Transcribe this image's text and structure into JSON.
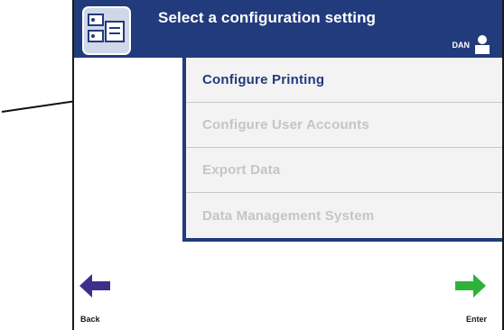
{
  "header": {
    "title": "Select a configuration setting",
    "user": "DAN",
    "icons": {
      "configuration": "configuration-icon",
      "user": "user-icon"
    }
  },
  "menu": {
    "items": [
      {
        "label": "Configure Printing",
        "state": "active"
      },
      {
        "label": "Configure User Accounts",
        "state": "disabled"
      },
      {
        "label": "Export Data",
        "state": "disabled"
      },
      {
        "label": "Data Management System",
        "state": "disabled"
      }
    ]
  },
  "footer": {
    "back_label": "Back",
    "enter_label": "Enter",
    "back_icon": "left-arrow-icon",
    "enter_icon": "right-arrow-icon"
  },
  "colors": {
    "header_bg": "#223b7c",
    "active_text": "#223b7c",
    "disabled_text": "#c5c5c5",
    "back_arrow": "#3f2e8c",
    "enter_arrow": "#2fb23a"
  }
}
